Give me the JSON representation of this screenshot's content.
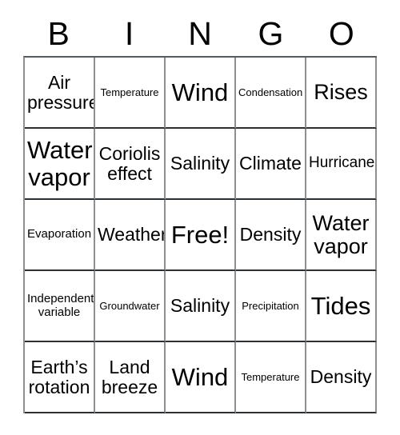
{
  "card": {
    "headers": [
      "B",
      "I",
      "N",
      "G",
      "O"
    ],
    "free_space_label": "Free!",
    "rows": [
      [
        {
          "text": "Air pressure",
          "size": "md"
        },
        {
          "text": "Temperature",
          "size": "xxs"
        },
        {
          "text": "Wind",
          "size": "xl"
        },
        {
          "text": "Condensation",
          "size": "xxs"
        },
        {
          "text": "Rises",
          "size": "lg"
        }
      ],
      [
        {
          "text": "Water vapor",
          "size": "xl"
        },
        {
          "text": "Coriolis effect",
          "size": "md"
        },
        {
          "text": "Salinity",
          "size": "md"
        },
        {
          "text": "Climate",
          "size": "md"
        },
        {
          "text": "Hurricane",
          "size": "sm"
        }
      ],
      [
        {
          "text": "Evaporation",
          "size": "xs"
        },
        {
          "text": "Weather",
          "size": "md"
        },
        {
          "text": "Free!",
          "size": "xl"
        },
        {
          "text": "Density",
          "size": "md"
        },
        {
          "text": "Water vapor",
          "size": "lg"
        }
      ],
      [
        {
          "text": "Independent variable",
          "size": "xs"
        },
        {
          "text": "Groundwater",
          "size": "xxs"
        },
        {
          "text": "Salinity",
          "size": "md"
        },
        {
          "text": "Precipitation",
          "size": "xxs"
        },
        {
          "text": "Tides",
          "size": "xl"
        }
      ],
      [
        {
          "text": "Earth’s rotation",
          "size": "md"
        },
        {
          "text": "Land breeze",
          "size": "md"
        },
        {
          "text": "Wind",
          "size": "xl"
        },
        {
          "text": "Temperature",
          "size": "xxs"
        },
        {
          "text": "Density",
          "size": "md"
        }
      ]
    ]
  },
  "colors": {
    "background": "#ffffff",
    "text": "#000000",
    "grid_line_horizontal": "#2b2f31",
    "grid_line_vertical": "#8c9093"
  }
}
